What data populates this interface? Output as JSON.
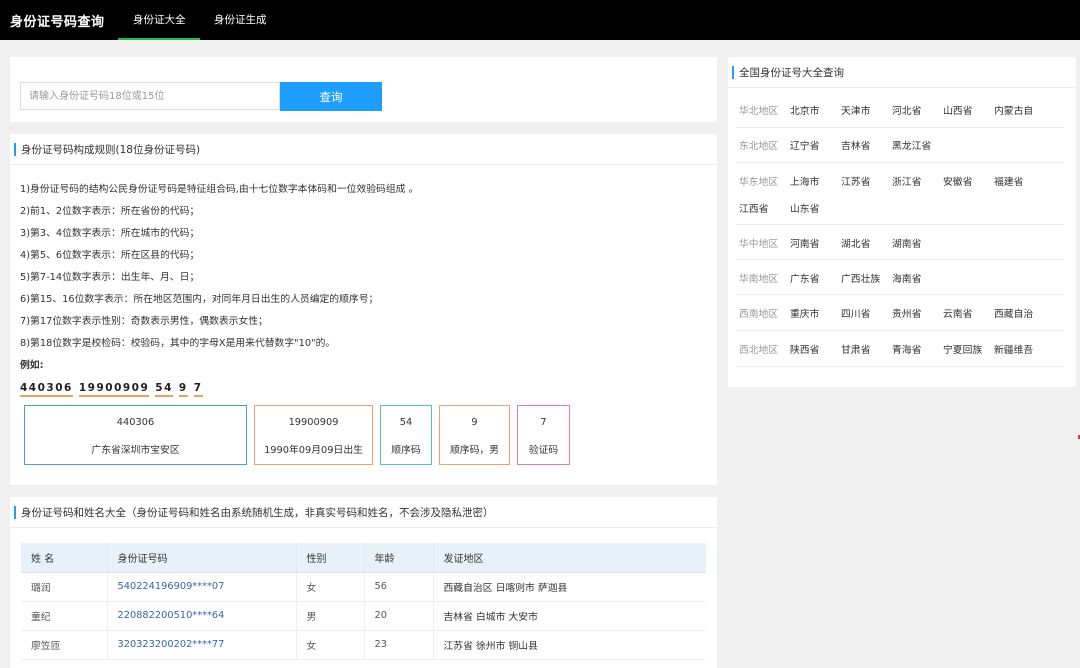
{
  "header": {
    "brand": "身份证号码查询",
    "tabs": [
      {
        "label": "身份证大全",
        "active": true
      },
      {
        "label": "身份证生成",
        "active": false
      }
    ]
  },
  "search": {
    "placeholder": "请输入身份证号码18位或15位",
    "value": "",
    "button": "查询"
  },
  "rules": {
    "title": "身份证号码构成规则(18位身份证号码)",
    "lines": [
      "1)身份证号码的结构公民身份证号码是特征组合码,由十七位数字本体码和一位效验码组成 。",
      "2)前1、2位数字表示：所在省份的代码；",
      "3)第3、4位数字表示：所在城市的代码；",
      "4)第5、6位数字表示：所在区县的代码；",
      "5)第7-14位数字表示：出生年、月、日；",
      "6)第15、16位数字表示：所在地区范围内，对同年月日出生的人员编定的顺序号；",
      "7)第17位数字表示性别：奇数表示男性，偶数表示女性；",
      "8)第18位数字是校检码：校验码，其中的字母X是用来代替数字\"10\"的。"
    ],
    "example_label": "例如:",
    "example_digits": [
      "440306",
      "19900909",
      "54",
      "9",
      "7"
    ],
    "segments": [
      {
        "value": "440306",
        "desc": "广东省深圳市宝安区"
      },
      {
        "value": "19900909",
        "desc": "1990年09月09日出生"
      },
      {
        "value": "54",
        "desc": "顺序码"
      },
      {
        "value": "9",
        "desc": "顺序码，男"
      },
      {
        "value": "7",
        "desc": "验证码"
      }
    ]
  },
  "table": {
    "title": "身份证号码和姓名大全（身份证号码和姓名由系统随机生成，非真实号码和姓名，不会涉及隐私泄密）",
    "headers": [
      "姓 名",
      "身份证号码",
      "性别",
      "年龄",
      "发证地区"
    ],
    "rows": [
      {
        "name": "璐润",
        "id": "540224196909****07",
        "gender": "女",
        "age": "56",
        "region": "西藏自治区 日喀则市 萨迦县"
      },
      {
        "name": "童纪",
        "id": "220882200510****64",
        "gender": "男",
        "age": "20",
        "region": "吉林省 白城市 大安市"
      },
      {
        "name": "廖笠匝",
        "id": "320323200202****77",
        "gender": "女",
        "age": "23",
        "region": "江苏省 徐州市 铜山县"
      }
    ]
  },
  "regions": {
    "title": "全国身份证号大全查询",
    "groups": [
      {
        "name": "华北地区",
        "provinces": [
          "北京市",
          "天津市",
          "河北省",
          "山西省",
          "内蒙古自"
        ]
      },
      {
        "name": "东北地区",
        "provinces": [
          "辽宁省",
          "吉林省",
          "黑龙江省"
        ]
      },
      {
        "name": "华东地区",
        "provinces": [
          "上海市",
          "江苏省",
          "浙江省",
          "安徽省",
          "福建省",
          "江西省",
          "山东省"
        ]
      },
      {
        "name": "华中地区",
        "provinces": [
          "河南省",
          "湖北省",
          "湖南省"
        ]
      },
      {
        "name": "华南地区",
        "provinces": [
          "广东省",
          "广西壮族",
          "海南省"
        ]
      },
      {
        "name": "西南地区",
        "provinces": [
          "重庆市",
          "四川省",
          "贵州省",
          "云南省",
          "西藏自治"
        ]
      },
      {
        "name": "西北地区",
        "provinces": [
          "陕西省",
          "甘肃省",
          "青海省",
          "宁夏回族",
          "新疆维吾"
        ]
      }
    ]
  },
  "colors": {
    "accent_blue": "#1e9fff",
    "nav_active": "#21ba45",
    "topbar": "#000000"
  }
}
